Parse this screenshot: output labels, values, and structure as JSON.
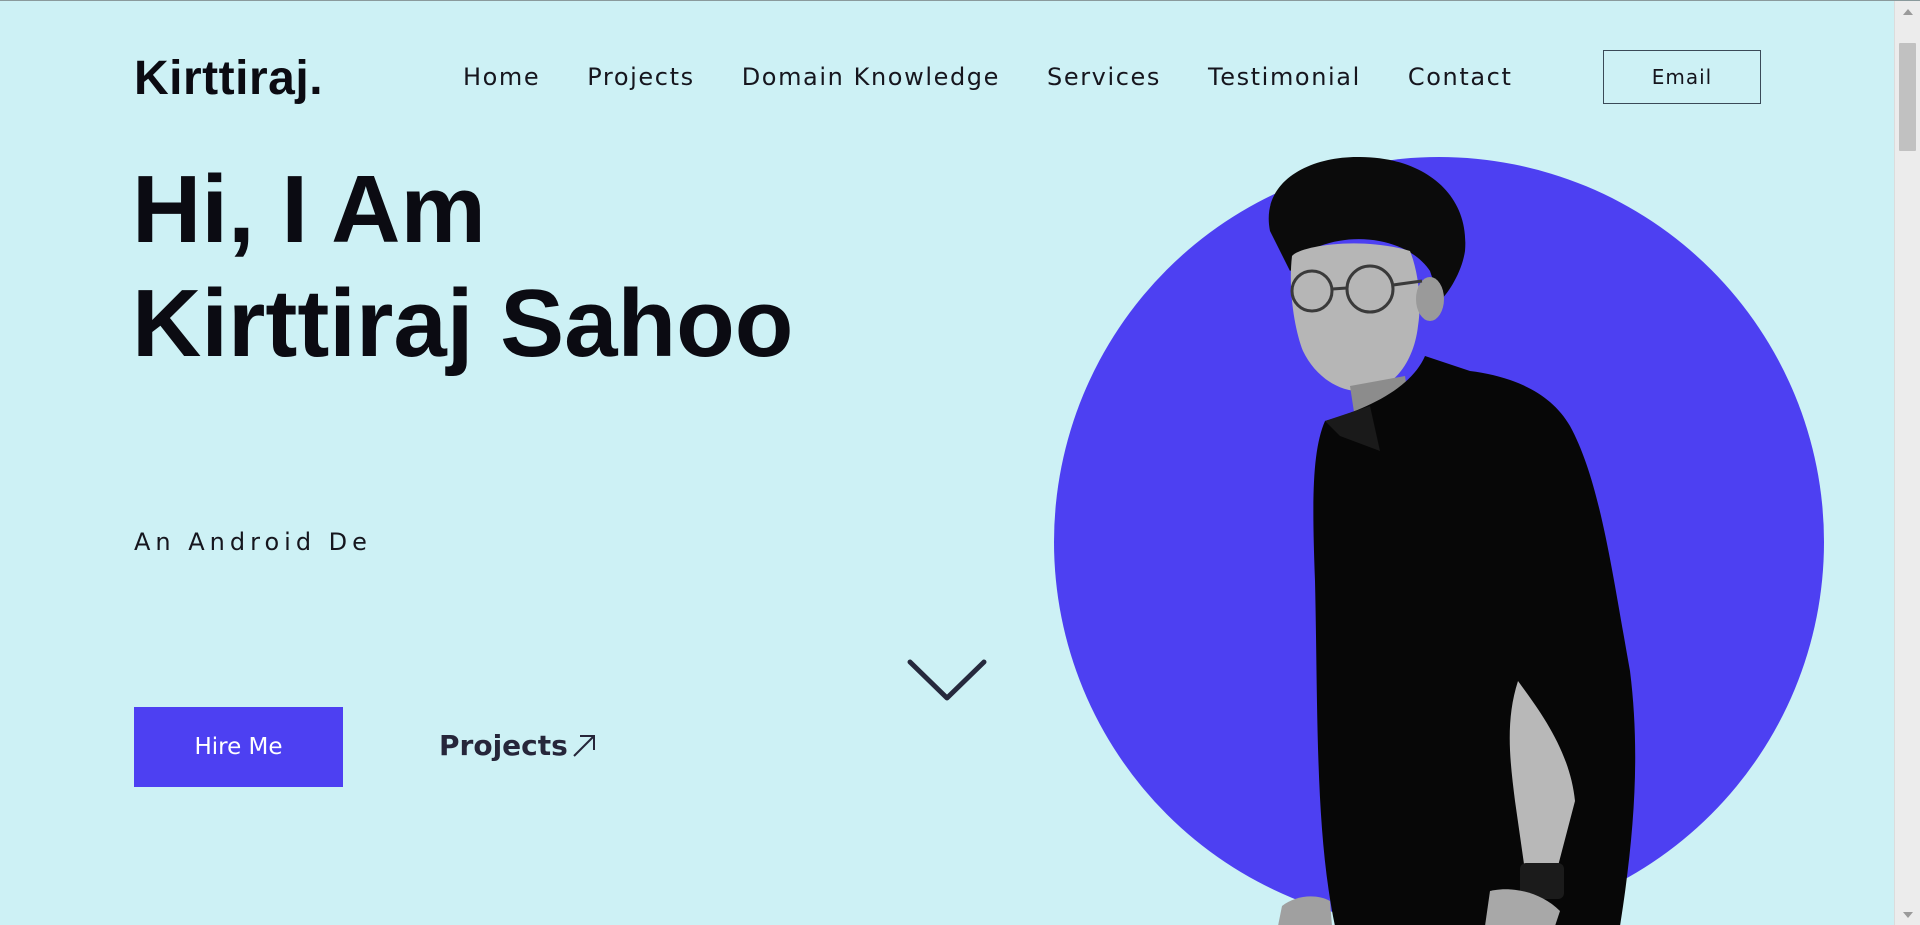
{
  "header": {
    "logo": "Kirttiraj.",
    "nav": [
      "Home",
      "Projects",
      "Domain Knowledge",
      "Services",
      "Testimonial",
      "Contact"
    ],
    "email_button": "Email"
  },
  "hero": {
    "title_line1": "Hi, I Am",
    "title_line2": "Kirttiraj Sahoo",
    "subtitle": "An Android De",
    "hire_button": "Hire Me",
    "projects_link": "Projects"
  },
  "icons": {
    "scroll_down": "chevron-down-icon",
    "projects_arrow": "arrow-up-right-icon"
  },
  "colors": {
    "background": "#cdf1f5",
    "accent": "#4d40f2",
    "text": "#0b0b12"
  }
}
